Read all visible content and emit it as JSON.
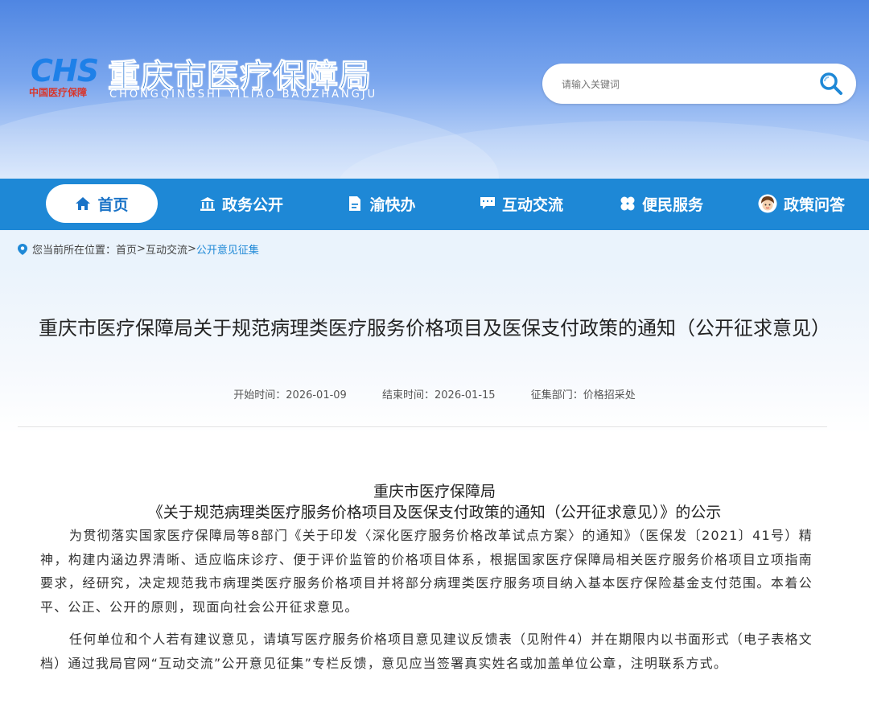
{
  "site": {
    "logo_mark": "CHS",
    "logo_sub": "中国医疗保障",
    "title": "重庆市医疗保障局",
    "pinyin": "CHONGQINGSHI  YILIAO  BAOZHANGJU"
  },
  "search": {
    "placeholder": "请输入关键词"
  },
  "nav": {
    "items": [
      {
        "label": "首页",
        "icon": "home-icon"
      },
      {
        "label": "政务公开",
        "icon": "building-icon"
      },
      {
        "label": "渝快办",
        "icon": "document-icon"
      },
      {
        "label": "互动交流",
        "icon": "chat-icon"
      },
      {
        "label": "便民服务",
        "icon": "clover-icon"
      },
      {
        "label": "政策问答",
        "icon": "avatar-icon"
      }
    ]
  },
  "breadcrumb": {
    "prefix": "您当前所在位置：",
    "home": "首页",
    "sep": ">",
    "section": "互动交流",
    "current": "公开意见征集"
  },
  "article": {
    "title": "重庆市医疗保障局关于规范病理类医疗服务价格项目及医保支付政策的通知（公开征求意见）",
    "start_label": "开始时间：",
    "start_date": "2026-01-09",
    "end_label": "结束时间：",
    "end_date": "2026-01-15",
    "dept_label": "征集部门：",
    "dept": "价格招采处",
    "doc_heading1": "重庆市医疗保障局",
    "doc_heading2": "《关于规范病理类医疗服务价格项目及医保支付政策的通知（公开征求意见）》的公示",
    "paragraphs": [
      "为贯彻落实国家医疗保障局等8部门《关于印发〈深化医疗服务价格改革试点方案〉的通知》（医保发〔2021〕41号）精神，构建内涵边界清晰、适应临床诊疗、便于评价监管的价格项目体系，根据国家医疗保障局相关医疗服务价格项目立项指南要求，经研究，决定规范我市病理类医疗服务价格项目并将部分病理类医疗服务项目纳入基本医疗保险基金支付范围。本着公平、公正、公开的原则，现面向社会公开征求意见。",
      "任何单位和个人若有建议意见，请填写医疗服务价格项目意见建议反馈表（见附件4）并在期限内以书面形式（电子表格文档）通过我局官网“互动交流”公开意见征集”专栏反馈，意见应当签署真实姓名或加盖单位公章，注明联系方式。"
    ]
  },
  "colors": {
    "nav_bg": "#1e88d6",
    "brand_blue": "#1b6fd1",
    "accent_red": "#d8362b"
  }
}
